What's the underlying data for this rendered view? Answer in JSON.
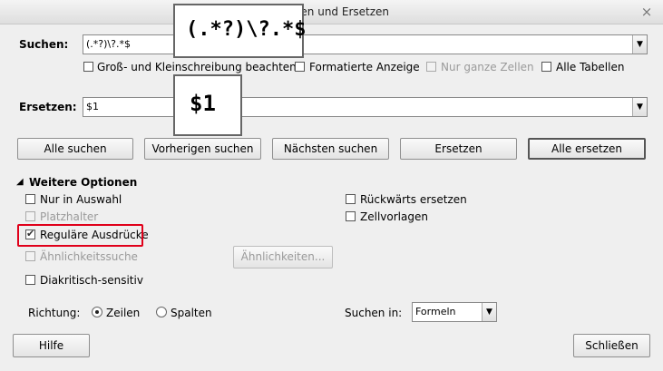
{
  "window": {
    "title": "Suchen und Ersetzen",
    "close_glyph": "×"
  },
  "search": {
    "label": "Suchen:",
    "value": "(.*?)\\?.*$"
  },
  "search_options": {
    "case": "Groß- und Kleinschreibung beachten",
    "formatted": "Formatierte Anzeige",
    "whole_cells": "Nur ganze Zellen",
    "all_sheets": "Alle Tabellen"
  },
  "replace": {
    "label": "Ersetzen:",
    "value": "$1"
  },
  "zoom": {
    "search": "(.*?)\\?.*$",
    "replace": "$1"
  },
  "buttons": {
    "find_all": "Alle suchen",
    "find_prev": "Vorherigen suchen",
    "find_next": "Nächsten suchen",
    "replace": "Ersetzen",
    "replace_all": "Alle ersetzen",
    "similarity": "Ähnlichkeiten...",
    "help": "Hilfe",
    "close": "Schließen"
  },
  "more_options": {
    "header": "Weitere Optionen",
    "current_selection": "Nur in Auswahl",
    "wildcards": "Platzhalter",
    "regex": "Reguläre Ausdrücke",
    "similarity_search": "Ähnlichkeitssuche",
    "diacritics": "Diakritisch-sensitiv",
    "backwards": "Rückwärts ersetzen",
    "cell_styles": "Zellvorlagen"
  },
  "direction": {
    "label": "Richtung:",
    "rows": "Zeilen",
    "columns": "Spalten",
    "selected": "rows"
  },
  "search_in": {
    "label": "Suchen in:",
    "value": "Formeln"
  },
  "colors": {
    "highlight": "#e0001a"
  }
}
